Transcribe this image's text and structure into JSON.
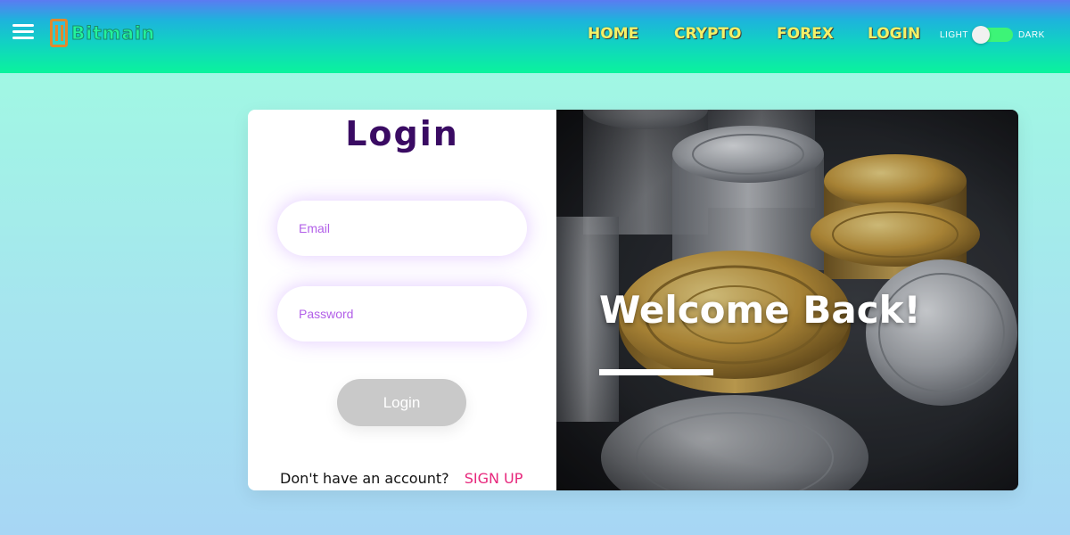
{
  "header": {
    "logo_text": "Bitmain",
    "nav": [
      {
        "label": "HOME"
      },
      {
        "label": "CRYPTO"
      },
      {
        "label": "FOREX"
      },
      {
        "label": "LOGIN"
      }
    ],
    "theme": {
      "light_label": "LIGHT",
      "dark_label": "DARK",
      "mode": "light"
    }
  },
  "login": {
    "title": "Login",
    "email_placeholder": "Email",
    "password_placeholder": "Password",
    "submit_label": "Login",
    "no_account_text": "Don't have an account?",
    "signup_label": "SIGN UP"
  },
  "hero": {
    "welcome": "Welcome Back!"
  },
  "colors": {
    "nav_text": "#f4f067",
    "title": "#3a0b63",
    "placeholder": "#b25fe8",
    "signup": "#e7277c",
    "toggle": "#3df477"
  },
  "icons": {
    "menu": "hamburger-icon",
    "logo": "bitmain-logo"
  }
}
